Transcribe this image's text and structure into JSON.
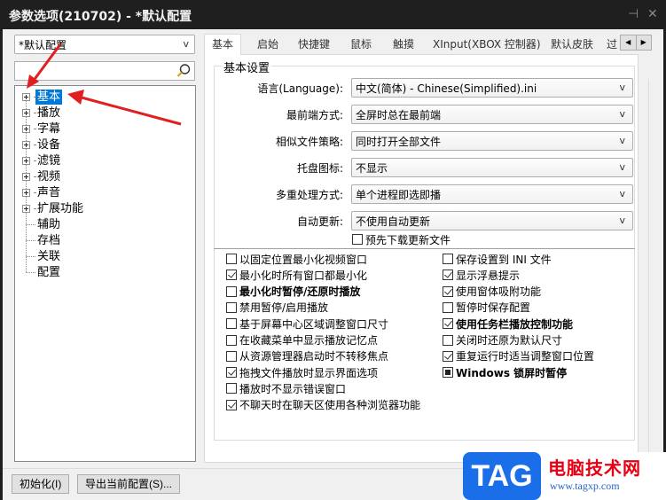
{
  "window": {
    "title": "参数选项(210702) - *默认配置",
    "pin_glyph": "⊣",
    "close_glyph": "✕"
  },
  "sidebar": {
    "profile_value": "*默认配置",
    "dropdown_arrow": "v",
    "search_placeholder": "",
    "tree": [
      {
        "label": "基本",
        "expandable": true,
        "selected": true
      },
      {
        "label": "播放",
        "expandable": true,
        "selected": false
      },
      {
        "label": "字幕",
        "expandable": true,
        "selected": false
      },
      {
        "label": "设备",
        "expandable": true,
        "selected": false
      },
      {
        "label": "滤镜",
        "expandable": true,
        "selected": false
      },
      {
        "label": "视频",
        "expandable": true,
        "selected": false
      },
      {
        "label": "声音",
        "expandable": true,
        "selected": false
      },
      {
        "label": "扩展功能",
        "expandable": true,
        "selected": false
      },
      {
        "label": "辅助",
        "expandable": false,
        "selected": false
      },
      {
        "label": "存档",
        "expandable": false,
        "selected": false
      },
      {
        "label": "关联",
        "expandable": false,
        "selected": false
      },
      {
        "label": "配置",
        "expandable": false,
        "selected": false
      }
    ]
  },
  "tabs": [
    {
      "label": "基本",
      "active": true
    },
    {
      "label": "启始",
      "active": false
    },
    {
      "label": "快捷键",
      "active": false
    },
    {
      "label": "鼠标",
      "active": false
    },
    {
      "label": "触摸",
      "active": false
    },
    {
      "label": "XInput(XBOX 控制器)",
      "active": false
    },
    {
      "label": "默认皮肤",
      "active": false
    },
    {
      "label": "过",
      "active": false
    }
  ],
  "tab_scroll": {
    "left": "◀",
    "right": "▶"
  },
  "basic_settings": {
    "title": "基本设置",
    "fields": [
      {
        "label": "语言(Language):",
        "value": "中文(简体) - Chinese(Simplified).ini"
      },
      {
        "label": "最前端方式:",
        "value": "全屏时总在最前端"
      },
      {
        "label": "相似文件策略:",
        "value": "同时打开全部文件"
      },
      {
        "label": "托盘图标:",
        "value": "不显示"
      },
      {
        "label": "多重处理方式:",
        "value": "单个进程即选即播"
      },
      {
        "label": "自动更新:",
        "value": "不使用自动更新"
      }
    ],
    "predownload": {
      "label": "预先下载更新文件",
      "checked": false
    }
  },
  "options_left": [
    {
      "label": "以固定位置最小化视频窗口",
      "state": "unchecked",
      "bold": false
    },
    {
      "label": "最小化时所有窗口都最小化",
      "state": "checked",
      "bold": false
    },
    {
      "label": "最小化时暂停/还原时播放",
      "state": "unchecked",
      "bold": true
    },
    {
      "label": "禁用暂停/启用播放",
      "state": "unchecked",
      "bold": false
    },
    {
      "label": "基于屏幕中心区域调整窗口尺寸",
      "state": "unchecked",
      "bold": false
    },
    {
      "label": "在收藏菜单中显示播放记忆点",
      "state": "unchecked",
      "bold": false
    },
    {
      "label": "从资源管理器启动时不转移焦点",
      "state": "unchecked",
      "bold": false
    },
    {
      "label": "拖拽文件播放时显示界面选项",
      "state": "checked",
      "bold": false
    },
    {
      "label": "播放时不显示错误窗口",
      "state": "unchecked",
      "bold": false
    },
    {
      "label": "不聊天时在聊天区使用各种浏览器功能",
      "state": "checked",
      "bold": false
    }
  ],
  "options_right": [
    {
      "label": "保存设置到 INI 文件",
      "state": "unchecked",
      "bold": false
    },
    {
      "label": "显示浮悬提示",
      "state": "checked",
      "bold": false
    },
    {
      "label": "使用窗体吸附功能",
      "state": "checked",
      "bold": false
    },
    {
      "label": "暂停时保存配置",
      "state": "unchecked",
      "bold": false
    },
    {
      "label": "使用任务栏播放控制功能",
      "state": "checked",
      "bold": true
    },
    {
      "label": "关闭时还原为默认尺寸",
      "state": "unchecked",
      "bold": false
    },
    {
      "label": "重复运行时适当调整窗口位置",
      "state": "checked",
      "bold": false
    },
    {
      "label": "Windows 锁屏时暂停",
      "state": "indeterminate",
      "bold": true
    }
  ],
  "footer": {
    "reset_label": "初始化(I)",
    "export_label": "导出当前配置(S)..."
  },
  "watermark": {
    "logo": "TAG",
    "site_name": "电脑技术网",
    "url": "www.tagxp.com"
  },
  "colors": {
    "selection": "#0078d7",
    "annotation_arrow": "#e02020",
    "watermark_blue": "#1a6fe8",
    "watermark_red": "#e60012"
  }
}
